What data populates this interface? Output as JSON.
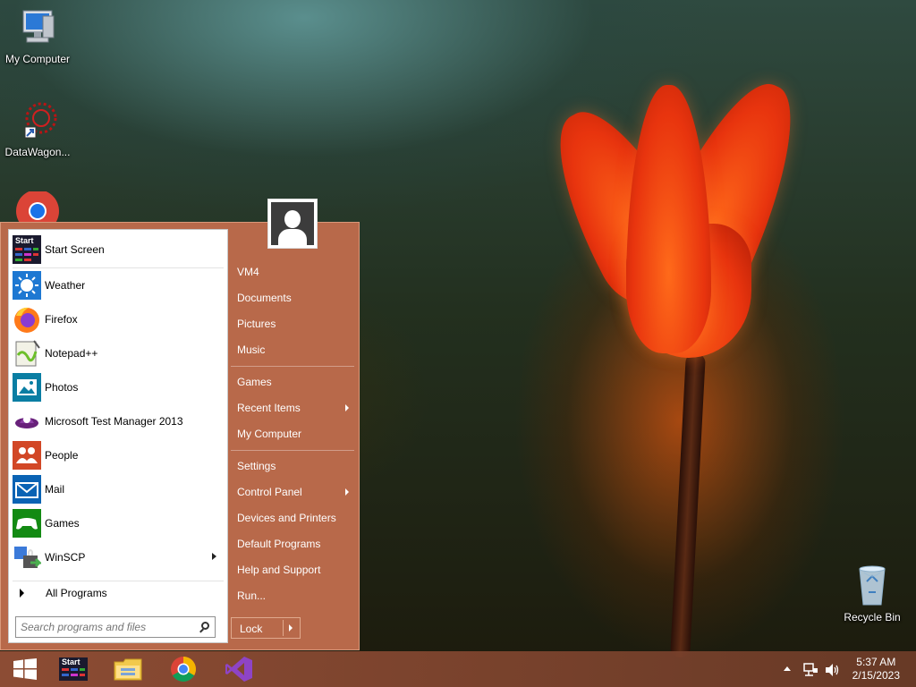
{
  "desktop": {
    "icons": [
      {
        "label": "My Computer",
        "icon": "computer-icon"
      },
      {
        "label": "DataWagon...",
        "icon": "datawagon-icon"
      },
      {
        "label": "",
        "icon": "chrome-icon"
      },
      {
        "label": "Recycle Bin",
        "icon": "recycle-bin-icon"
      }
    ]
  },
  "start_menu": {
    "pinned": [
      {
        "label": "Start Screen",
        "icon": "start-screen-icon"
      },
      {
        "label": "Weather",
        "icon": "weather-icon"
      },
      {
        "label": "Firefox",
        "icon": "firefox-icon"
      },
      {
        "label": "Notepad++",
        "icon": "notepadpp-icon"
      },
      {
        "label": "Photos",
        "icon": "photos-icon"
      },
      {
        "label": "Microsoft Test Manager 2013",
        "icon": "test-manager-icon"
      },
      {
        "label": "People",
        "icon": "people-icon"
      },
      {
        "label": "Mail",
        "icon": "mail-icon"
      },
      {
        "label": "Games",
        "icon": "games-icon"
      },
      {
        "label": "WinSCP",
        "icon": "winscp-icon",
        "has_submenu": true
      }
    ],
    "start_tile_text": "Start",
    "all_programs": "All Programs",
    "search_placeholder": "Search programs and files",
    "right": [
      {
        "label": "VM4"
      },
      {
        "label": "Documents"
      },
      {
        "label": "Pictures"
      },
      {
        "label": "Music"
      },
      {
        "label": "Games"
      },
      {
        "label": "Recent Items",
        "has_submenu": true
      },
      {
        "label": "My Computer"
      },
      {
        "label": "Settings"
      },
      {
        "label": "Control Panel",
        "has_submenu": true
      },
      {
        "label": "Devices and Printers"
      },
      {
        "label": "Default Programs"
      },
      {
        "label": "Help and Support"
      },
      {
        "label": "Run..."
      }
    ],
    "lock_label": "Lock",
    "accent_color": "#b8694a"
  },
  "taskbar": {
    "buttons": [
      {
        "icon": "windows-logo-icon"
      },
      {
        "icon": "start-screen-icon",
        "text": "Start"
      },
      {
        "icon": "file-explorer-icon"
      },
      {
        "icon": "chrome-icon"
      },
      {
        "icon": "visual-studio-icon"
      }
    ],
    "clock_time": "5:37 AM",
    "clock_date": "2/15/2023"
  }
}
